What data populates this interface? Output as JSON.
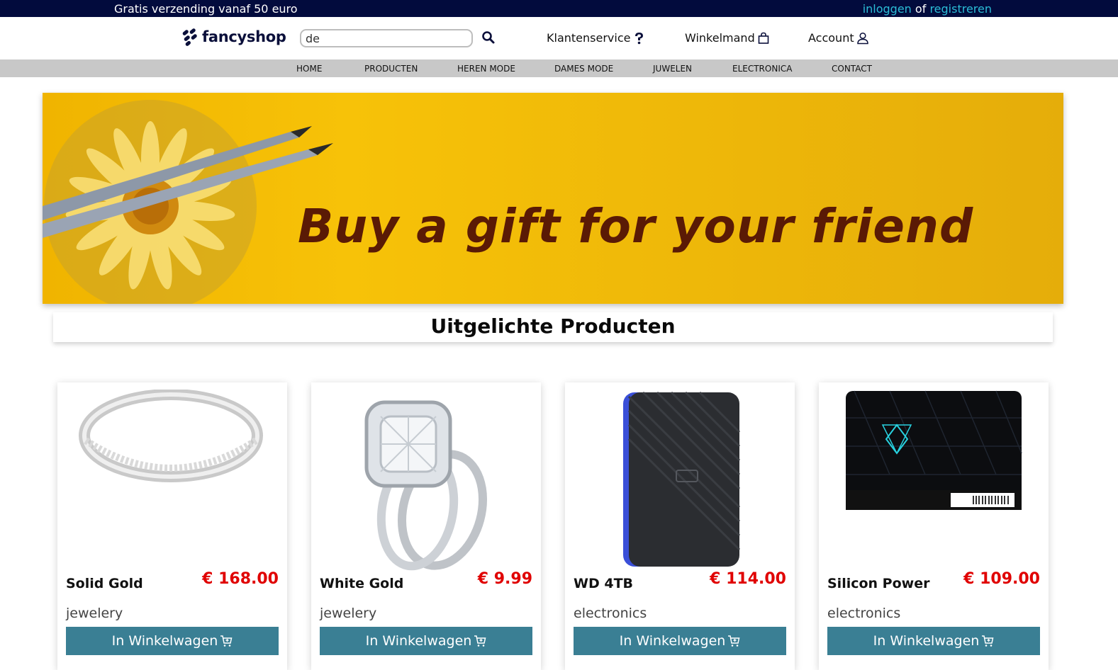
{
  "topbar": {
    "promo": "Gratis verzending vanaf 50 euro",
    "login": "inloggen",
    "or": "of",
    "register": "registreren"
  },
  "header": {
    "logo_text": "fancyshop",
    "search_value": "de",
    "customer_service": "Klantenservice",
    "cart": "Winkelmand",
    "account": "Account"
  },
  "nav": {
    "items": [
      "HOME",
      "PRODUCTEN",
      "HEREN MODE",
      "DAMES MODE",
      "JUWELEN",
      "ELECTRONICA",
      "CONTACT"
    ]
  },
  "banner": {
    "tagline": "Buy a gift for your friend"
  },
  "featured": {
    "title": "Uitgelichte Producten",
    "products": [
      {
        "name": "Solid Gold",
        "price": "€ 168.00",
        "category": "jewelery",
        "button": "In Winkelwagen"
      },
      {
        "name": "White Gold",
        "price": "€ 9.99",
        "category": "jewelery",
        "button": "In Winkelwagen"
      },
      {
        "name": "WD 4TB",
        "price": "€ 114.00",
        "category": "electronics",
        "button": "In Winkelwagen"
      },
      {
        "name": "Silicon Power",
        "price": "€ 109.00",
        "category": "electronics",
        "button": "In Winkelwagen"
      }
    ]
  },
  "colors": {
    "topbar": "#020b3d",
    "link": "#2bbcd6",
    "nav": "#c8c8c8",
    "banner": "#f7c208",
    "price": "#e00000",
    "button": "#3a7f94"
  }
}
